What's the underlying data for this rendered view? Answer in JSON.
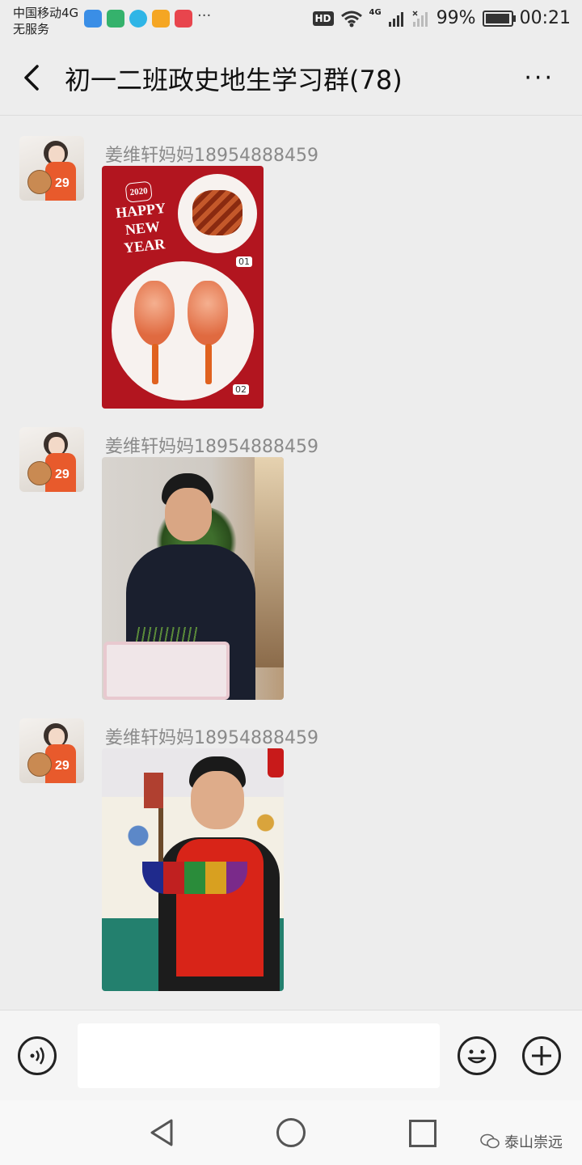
{
  "status_bar": {
    "carrier_line1": "中国移动4G",
    "carrier_line2": "无服务",
    "hd_label": "HD",
    "network_label": "4G",
    "battery": "99%",
    "battery_level": 0.99,
    "time": "00:21",
    "more_dots": "···"
  },
  "header": {
    "title": "初一二班政史地生学习群(78)",
    "more_icon": "more-horizontal-icon",
    "more_glyph": "···"
  },
  "messages": [
    {
      "sender": "姜维轩妈妈18954888459",
      "type": "image",
      "image": "new-year-shrimp-card"
    },
    {
      "sender": "姜维轩妈妈18954888459",
      "type": "image",
      "image": "boy-with-sprouts-basket"
    },
    {
      "sender": "姜维轩妈妈18954888459",
      "type": "image",
      "image": "boy-with-handmade-boat"
    }
  ],
  "card": {
    "year": "2020",
    "line1": "HAPPY",
    "line2": "NEW",
    "line3": "YEAR",
    "label1": "01",
    "label2": "02"
  },
  "input_bar": {
    "voice_icon": "voice-icon",
    "emoji_icon": "emoji-icon",
    "add_icon": "add-icon"
  },
  "nav_bar": {
    "back_icon": "nav-back-icon",
    "home_icon": "nav-home-icon",
    "recent_icon": "nav-recent-icon",
    "watermark": "泰山崇远"
  },
  "colors": {
    "card_red": "#b2151f",
    "background": "#ededed"
  }
}
